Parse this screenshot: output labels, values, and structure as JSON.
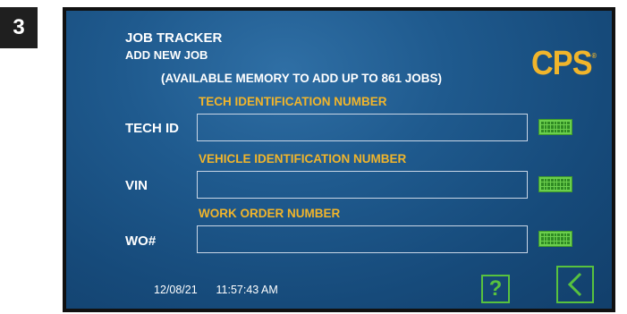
{
  "step_number": "3",
  "header": {
    "title": "JOB TRACKER",
    "subtitle": "ADD NEW JOB",
    "memory_note": "(AVAILABLE MEMORY TO ADD UP TO 861 JOBS)"
  },
  "logo": {
    "text": "CPS",
    "mark": "®"
  },
  "fields": [
    {
      "section_label": "TECH IDENTIFICATION NUMBER",
      "label": "TECH ID",
      "value": "",
      "keyboard_icon": "keyboard-icon"
    },
    {
      "section_label": "VEHICLE IDENTIFICATION NUMBER",
      "label": "VIN",
      "value": "",
      "keyboard_icon": "keyboard-icon"
    },
    {
      "section_label": "WORK ORDER NUMBER",
      "label": "WO#",
      "value": "",
      "keyboard_icon": "keyboard-icon"
    }
  ],
  "status": {
    "date": "12/08/21",
    "time": "11:57:43 AM"
  },
  "buttons": {
    "help_label": "?",
    "back_icon": "chevron-left-icon"
  },
  "colors": {
    "accent_yellow": "#f1b52b",
    "button_green": "#58c23e",
    "panel_blue": "#1f5a8e"
  }
}
